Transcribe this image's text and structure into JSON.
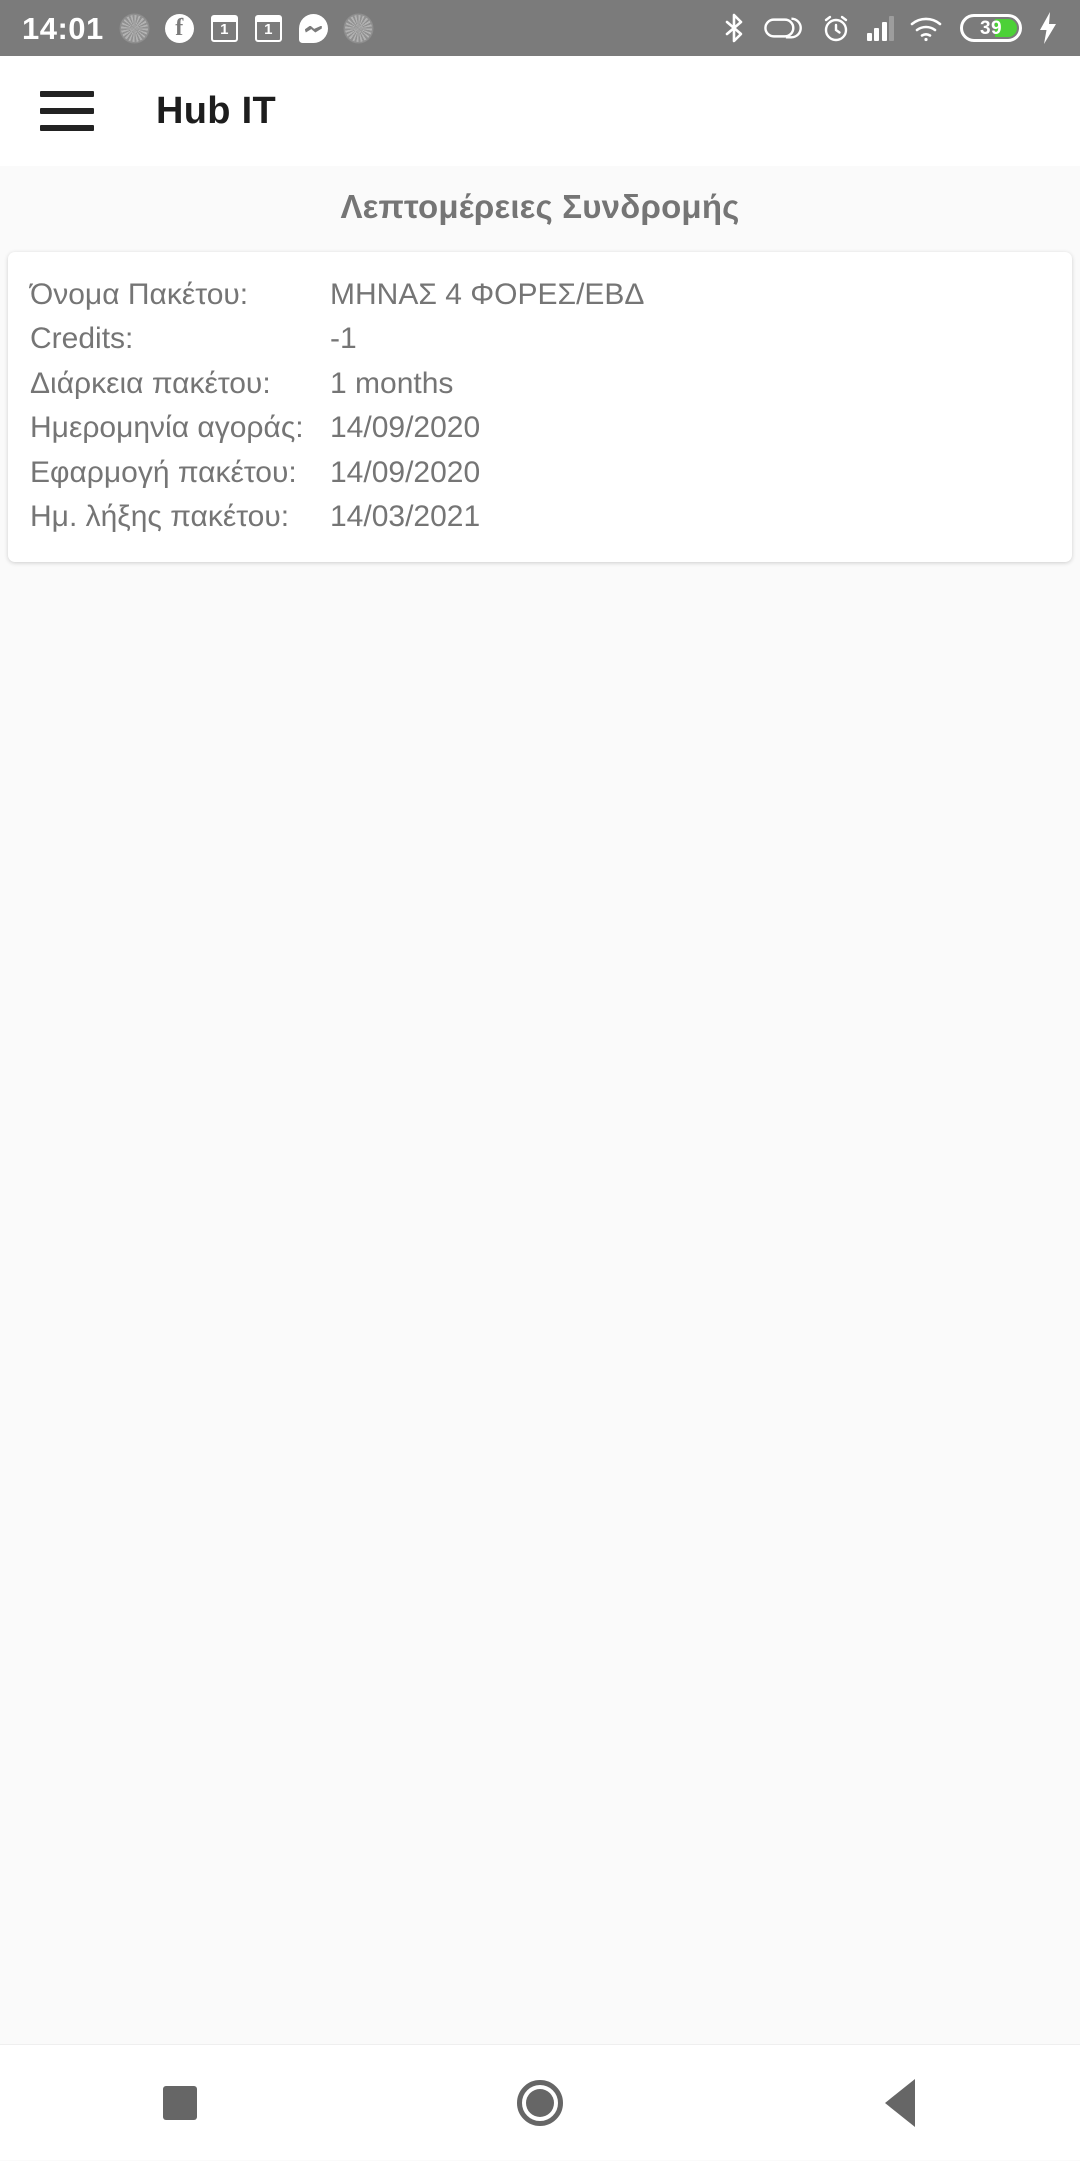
{
  "status_bar": {
    "time": "14:01",
    "battery_percent": "39",
    "notification_icons": [
      "blurred-app-icon",
      "facebook-icon",
      "calendar-badge-1-icon",
      "calendar-badge-1-icon",
      "messenger-icon",
      "blurred-app-icon"
    ],
    "system_icons": [
      "bluetooth-icon",
      "vpn-pill-icon",
      "alarm-icon",
      "cellular-signal-icon",
      "wifi-icon",
      "battery-icon",
      "charging-bolt-icon"
    ],
    "badge_counts": [
      "1",
      "1"
    ],
    "background_color": "#7b7b7b",
    "battery_fill_color": "#4cd137"
  },
  "app_bar": {
    "menu_icon": "hamburger-menu-icon",
    "title": "Hub IT"
  },
  "main": {
    "section_title": "Λεπτομέρειες Συνδρομής",
    "details": [
      {
        "label": "Όνομα Πακέτου:",
        "value": "ΜΗΝΑΣ 4 ΦΟΡΕΣ/ΕΒΔ"
      },
      {
        "label": "Credits:",
        "value": "-1"
      },
      {
        "label": "Διάρκεια πακέτου:",
        "value": "1 months"
      },
      {
        "label": "Ημερομηνία αγοράς:",
        "value": "14/09/2020"
      },
      {
        "label": "Εφαρμογή πακέτου:",
        "value": "14/09/2020"
      },
      {
        "label": "Ημ. λήξης πακέτου:",
        "value": "14/03/2021"
      }
    ]
  },
  "navigation_bar": {
    "buttons": [
      {
        "name": "recents-button",
        "icon": "square-icon"
      },
      {
        "name": "home-button",
        "icon": "circle-icon"
      },
      {
        "name": "back-button",
        "icon": "triangle-left-icon"
      }
    ]
  }
}
